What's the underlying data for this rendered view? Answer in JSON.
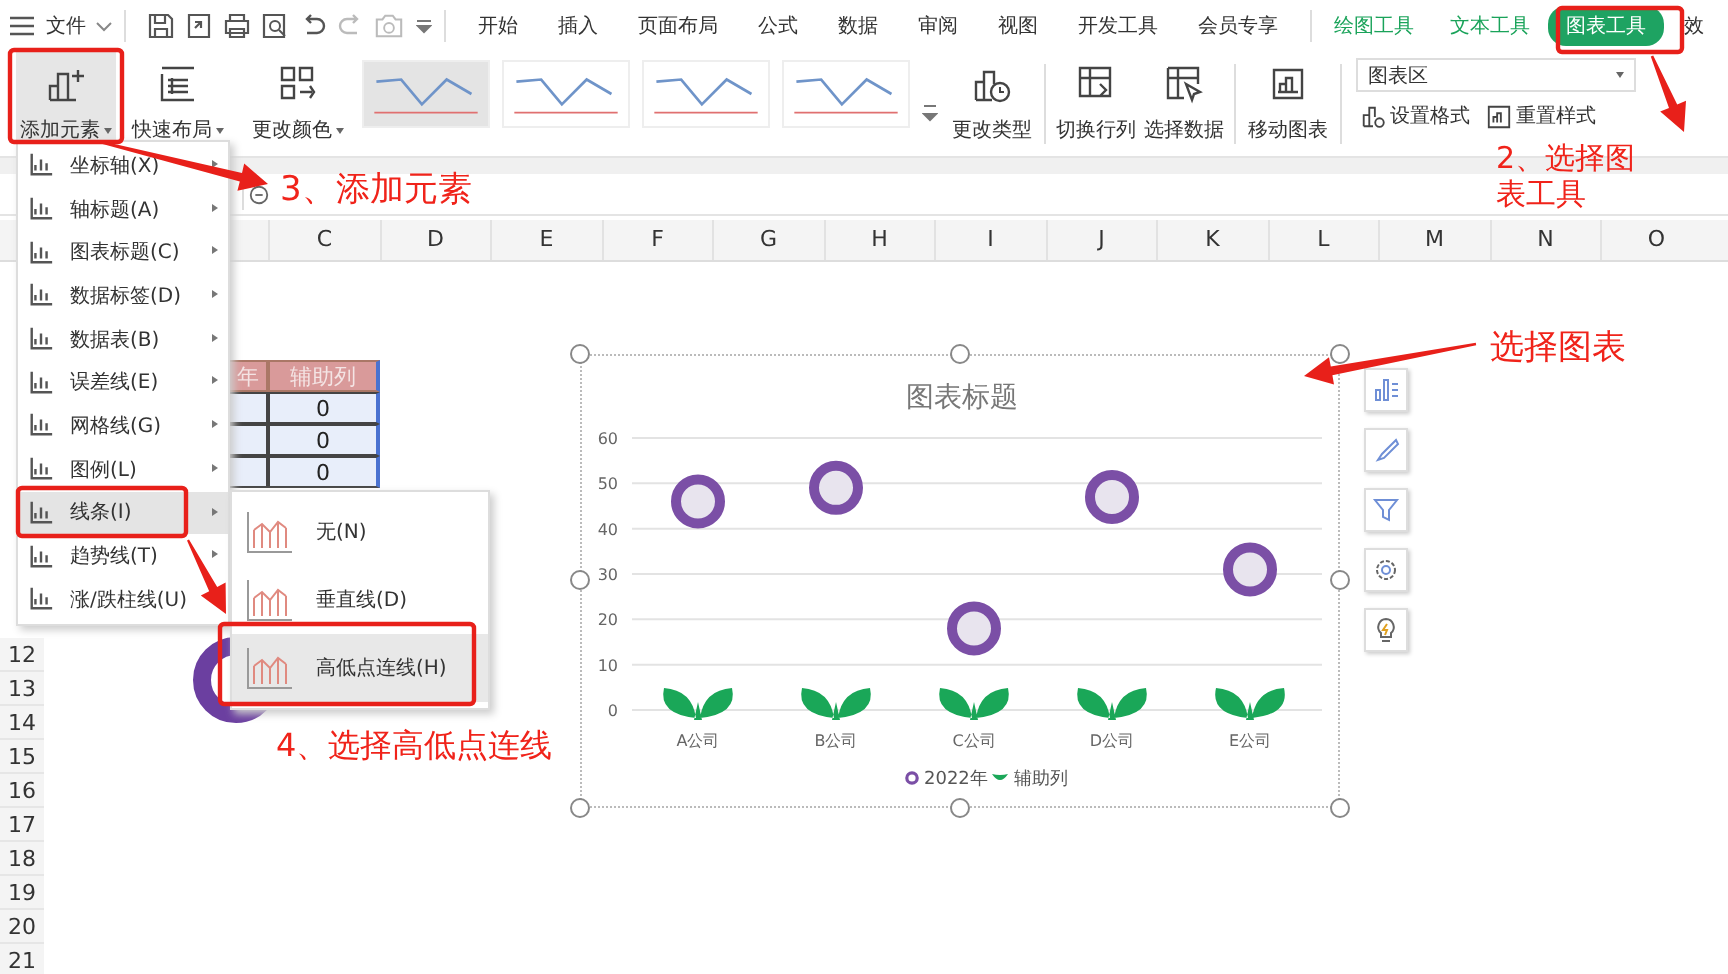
{
  "title_bar": {
    "menu_label": "文件",
    "tabs": [
      {
        "label": "开始",
        "kind": "main",
        "selected": false
      },
      {
        "label": "插入",
        "kind": "main",
        "selected": false
      },
      {
        "label": "页面布局",
        "kind": "main",
        "selected": false
      },
      {
        "label": "公式",
        "kind": "main",
        "selected": false
      },
      {
        "label": "数据",
        "kind": "main",
        "selected": false
      },
      {
        "label": "审阅",
        "kind": "main",
        "selected": false
      },
      {
        "label": "视图",
        "kind": "main",
        "selected": false
      },
      {
        "label": "开发工具",
        "kind": "main",
        "selected": false
      },
      {
        "label": "会员专享",
        "kind": "main",
        "selected": false
      },
      {
        "label": "绘图工具",
        "kind": "context",
        "selected": false
      },
      {
        "label": "文本工具",
        "kind": "context",
        "selected": false
      },
      {
        "label": "图表工具",
        "kind": "context",
        "selected": true
      },
      {
        "label": "效",
        "kind": "main",
        "selected": false
      }
    ]
  },
  "ribbon": {
    "left_buttons": [
      {
        "label": "添加元素",
        "dropdown": true,
        "open": true
      },
      {
        "label": "快速布局",
        "dropdown": true,
        "open": false
      },
      {
        "label": "更改颜色",
        "dropdown": true,
        "open": false
      }
    ],
    "right_buttons": [
      {
        "label": "更改类型",
        "dropdown": false,
        "open": false
      },
      {
        "label": "切换行列",
        "dropdown": false,
        "open": false
      },
      {
        "label": "选择数据",
        "dropdown": false,
        "open": false
      },
      {
        "label": "移动图表",
        "dropdown": false,
        "open": false
      }
    ],
    "element_select": {
      "value": "图表区"
    },
    "format_buttons": [
      "设置格式",
      "重置样式"
    ]
  },
  "sheet": {
    "columns": [
      "C",
      "D",
      "E",
      "F",
      "G",
      "H",
      "I",
      "J",
      "K",
      "L",
      "M",
      "N",
      "O"
    ],
    "rows": [
      "12",
      "13",
      "14",
      "15",
      "16",
      "17",
      "18",
      "19",
      "20",
      "21"
    ],
    "table": {
      "header": [
        "年",
        "辅助列"
      ],
      "values": [
        "0",
        "0",
        "0"
      ]
    }
  },
  "chart": {
    "chart_data": {
      "type": "scatter",
      "title": "图表标题",
      "categories": [
        "A公司",
        "B公司",
        "C公司",
        "D公司",
        "E公司"
      ],
      "series": [
        {
          "name": "2022年",
          "color": "#7b4fa6",
          "values": [
            46,
            49,
            18,
            47,
            31
          ]
        },
        {
          "name": "辅助列",
          "color": "#1aa758",
          "values": [
            0,
            0,
            0,
            0,
            0
          ]
        }
      ],
      "grid": true,
      "legend": "bottom",
      "ylim": [
        0,
        60
      ],
      "yticks": [
        0,
        10,
        20,
        30,
        40,
        50,
        60
      ]
    }
  },
  "add_element_menu": {
    "items": [
      {
        "label": "坐标轴(X)",
        "selected": false
      },
      {
        "label": "轴标题(A)",
        "selected": false
      },
      {
        "label": "图表标题(C)",
        "selected": false
      },
      {
        "label": "数据标签(D)",
        "selected": false
      },
      {
        "label": "数据表(B)",
        "selected": false
      },
      {
        "label": "误差线(E)",
        "selected": false
      },
      {
        "label": "网格线(G)",
        "selected": false
      },
      {
        "label": "图例(L)",
        "selected": false
      },
      {
        "label": "线条(I)",
        "selected": true
      },
      {
        "label": "趋势线(T)",
        "selected": false
      },
      {
        "label": "涨/跌柱线(U)",
        "selected": false
      }
    ]
  },
  "lines_submenu": {
    "items": [
      {
        "label": "无(N)",
        "selected": false
      },
      {
        "label": "垂直线(D)",
        "selected": false
      },
      {
        "label": "高低点连线(H)",
        "selected": true
      }
    ]
  },
  "annotations": [
    "3、添加元素",
    "2、选择图表工具",
    "选择图表",
    "4、选择高低点连线"
  ]
}
